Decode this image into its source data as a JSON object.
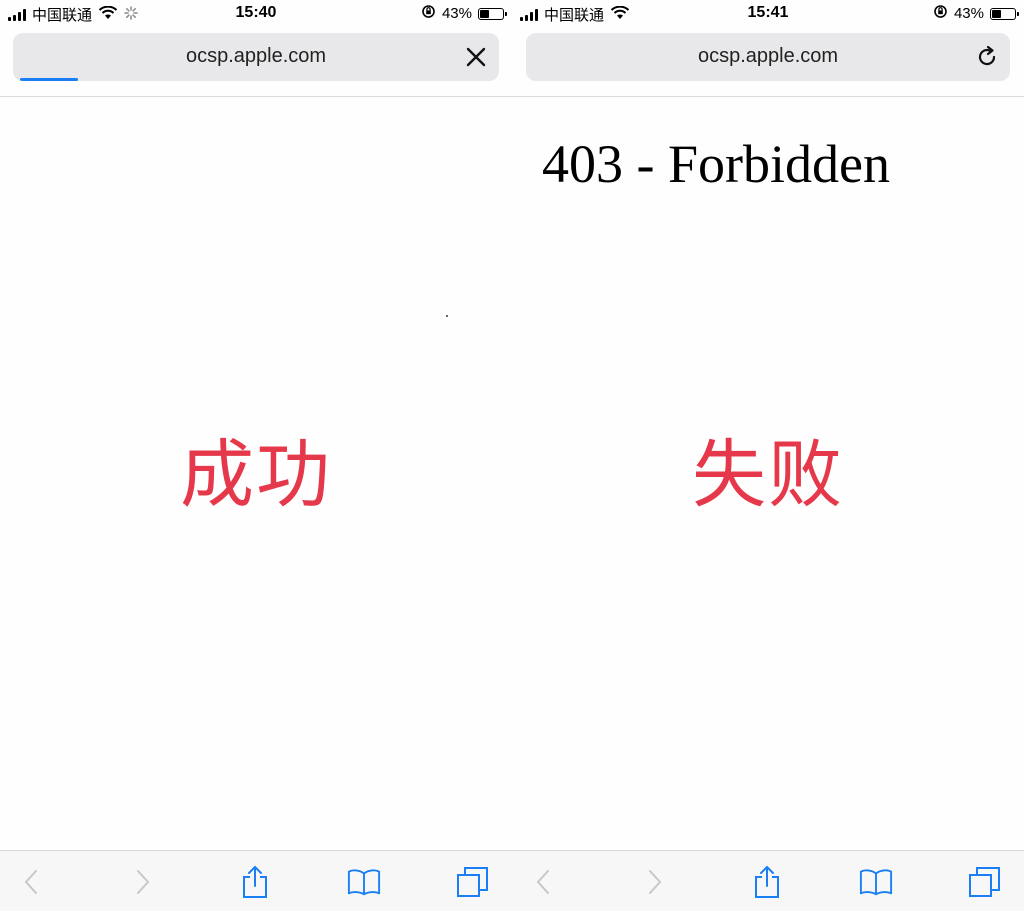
{
  "panels": [
    {
      "status": {
        "carrier": "中国联通",
        "time": "15:40",
        "battery": "43%",
        "battery_level": 0.43
      },
      "urlbar": {
        "url": "ocsp.apple.com",
        "action_icon": "close-icon",
        "loading_progress": 0.12
      },
      "content": {
        "heading": "",
        "caption": "成功"
      },
      "toolbar": {
        "icons": [
          "chevron-left-icon",
          "chevron-right-icon",
          "share-icon",
          "bookmarks-icon",
          "tabs-icon"
        ]
      }
    },
    {
      "status": {
        "carrier": "中国联通",
        "time": "15:41",
        "battery": "43%",
        "battery_level": 0.43
      },
      "urlbar": {
        "url": "ocsp.apple.com",
        "action_icon": "reload-icon"
      },
      "content": {
        "heading": "403 - Forbidden",
        "caption": "失败"
      },
      "toolbar": {
        "icons": [
          "chevron-left-icon",
          "chevron-right-icon",
          "share-icon",
          "bookmarks-icon",
          "tabs-icon"
        ]
      }
    }
  ],
  "colors": {
    "caption": "#e5394b",
    "progress": "#1a7ff2",
    "toolbar_icon": "#1a7ff2",
    "disabled_icon": "#c8c8cc"
  }
}
